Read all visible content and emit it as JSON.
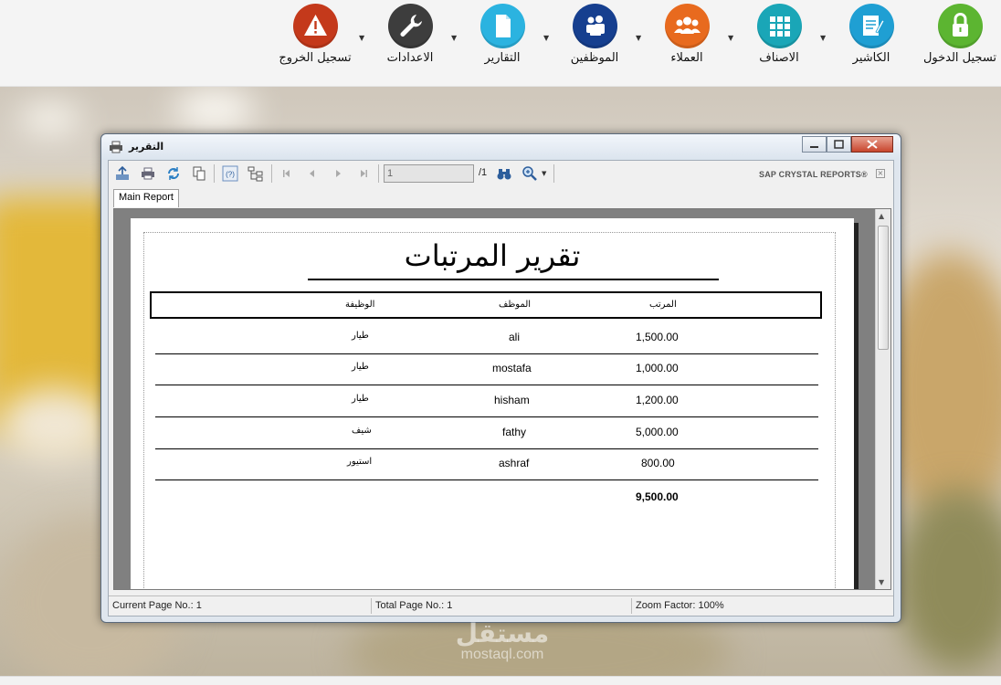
{
  "nav": {
    "items": [
      {
        "label": "تسجيل الدخول",
        "icon": "lock-icon",
        "color": "#5cb531"
      },
      {
        "label": "الكاشير",
        "icon": "cashier-document-icon",
        "color": "#1f9fd3"
      },
      {
        "label": "الاصناف",
        "icon": "grid-icon",
        "color": "#1aa6b7"
      },
      {
        "label": "العملاء",
        "icon": "customers-group-icon",
        "color": "#e86a1e"
      },
      {
        "label": "الموظفين",
        "icon": "employees-group-icon",
        "color": "#163f8f"
      },
      {
        "label": "التقارير",
        "icon": "report-document-icon",
        "color": "#2bb3e0"
      },
      {
        "label": "الاعدادات",
        "icon": "wrench-icon",
        "color": "#3d3d3d"
      },
      {
        "label": "تسجيل الخروج",
        "icon": "warning-icon",
        "color": "#c4391b"
      }
    ]
  },
  "window": {
    "title": "التقرير"
  },
  "toolbar": {
    "page_value": "1",
    "page_of": "/1",
    "brand": "SAP CRYSTAL REPORTS®"
  },
  "tab": {
    "label": "Main Report"
  },
  "report": {
    "title": "تقرير المرتبات",
    "headers": {
      "salary": "المرتب",
      "employee": "الموظف",
      "job": "الوظيفة"
    },
    "rows": [
      {
        "salary": "1,500.00",
        "employee": "ali",
        "job": "طيار"
      },
      {
        "salary": "1,000.00",
        "employee": "mostafa",
        "job": "طيار"
      },
      {
        "salary": "1,200.00",
        "employee": "hisham",
        "job": "طيار"
      },
      {
        "salary": "5,000.00",
        "employee": "fathy",
        "job": "شيف"
      },
      {
        "salary": "800.00",
        "employee": "ashraf",
        "job": "استيور"
      }
    ],
    "total": "9,500.00"
  },
  "status": {
    "current_page": "Current Page No.: 1",
    "total_page": "Total Page No.: 1",
    "zoom": "Zoom Factor: 100%"
  },
  "watermark": {
    "arabic": "مستقل",
    "latin": "mostaql.com"
  }
}
